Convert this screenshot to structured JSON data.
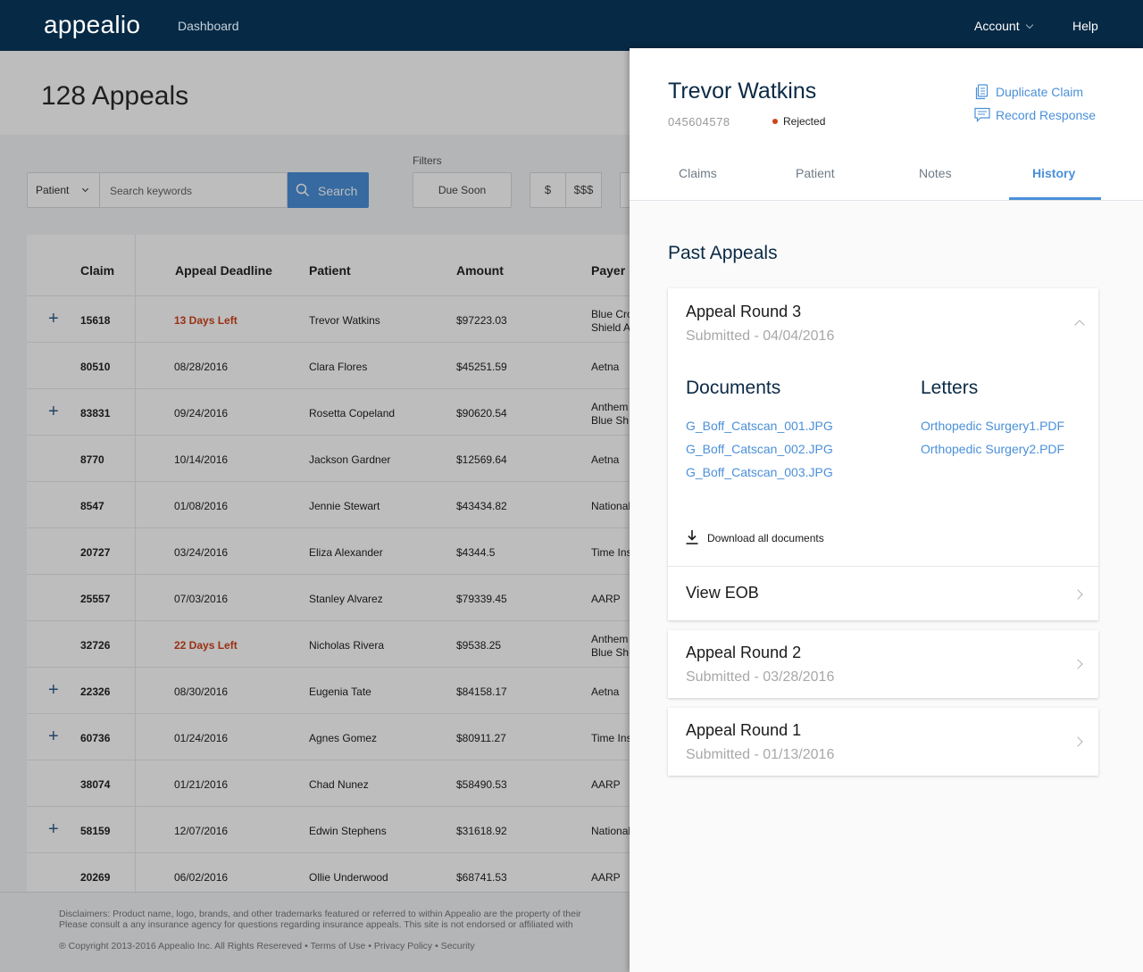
{
  "nav": {
    "brand": "appealio",
    "dashboard": "Dashboard",
    "account": "Account",
    "help": "Help"
  },
  "page": {
    "title": "128 Appeals",
    "filters_label": "Filters",
    "search": {
      "select_value": "Patient",
      "placeholder": "Search keywords",
      "button": "Search"
    },
    "filter_buttons": [
      "Due Soon",
      "$",
      "$$$"
    ]
  },
  "table": {
    "headers": {
      "claim": "Claim",
      "deadline": "Appeal Deadline",
      "patient": "Patient",
      "amount": "Amount",
      "payer": "Payer"
    },
    "rows": [
      {
        "claim": "15618",
        "deadline": "13 Days Left",
        "urgent": true,
        "patient": "Trevor Watkins",
        "amount": "$97223.03",
        "payer": "Blue Cross Shield A",
        "plus": true
      },
      {
        "claim": "80510",
        "deadline": "08/28/2016",
        "urgent": false,
        "patient": "Clara Flores",
        "amount": "$45251.59",
        "payer": "Aetna",
        "plus": false
      },
      {
        "claim": "83831",
        "deadline": "09/24/2016",
        "urgent": false,
        "patient": "Rosetta Copeland",
        "amount": "$90620.54",
        "payer": "Anthem Blue Sh",
        "plus": true
      },
      {
        "claim": "8770",
        "deadline": "10/14/2016",
        "urgent": false,
        "patient": "Jackson Gardner",
        "amount": "$12569.64",
        "payer": "Aetna",
        "plus": false
      },
      {
        "claim": "8547",
        "deadline": "01/08/2016",
        "urgent": false,
        "patient": "Jennie Stewart",
        "amount": "$43434.82",
        "payer": "National",
        "plus": false
      },
      {
        "claim": "20727",
        "deadline": "03/24/2016",
        "urgent": false,
        "patient": "Eliza Alexander",
        "amount": "$4344.5",
        "payer": "Time Ins",
        "plus": false
      },
      {
        "claim": "25557",
        "deadline": "07/03/2016",
        "urgent": false,
        "patient": "Stanley Alvarez",
        "amount": "$79339.45",
        "payer": "AARP",
        "plus": false
      },
      {
        "claim": "32726",
        "deadline": "22 Days Left",
        "urgent": true,
        "patient": "Nicholas Rivera",
        "amount": "$9538.25",
        "payer": "Anthem Blue Sh",
        "plus": false
      },
      {
        "claim": "22326",
        "deadline": "08/30/2016",
        "urgent": false,
        "patient": "Eugenia Tate",
        "amount": "$84158.17",
        "payer": "Aetna",
        "plus": true
      },
      {
        "claim": "60736",
        "deadline": "01/24/2016",
        "urgent": false,
        "patient": "Agnes Gomez",
        "amount": "$80911.27",
        "payer": "Time Ins",
        "plus": true
      },
      {
        "claim": "38074",
        "deadline": "01/21/2016",
        "urgent": false,
        "patient": "Chad Nunez",
        "amount": "$58490.53",
        "payer": "AARP",
        "plus": false
      },
      {
        "claim": "58159",
        "deadline": "12/07/2016",
        "urgent": false,
        "patient": "Edwin Stephens",
        "amount": "$31618.92",
        "payer": "National",
        "plus": true
      },
      {
        "claim": "20269",
        "deadline": "06/02/2016",
        "urgent": false,
        "patient": "Ollie Underwood",
        "amount": "$68741.53",
        "payer": "AARP",
        "plus": false
      }
    ]
  },
  "footer": {
    "disclaimer_1": "Disclaimers: Product name, logo, brands, and other trademarks featured or referred to within Appealio are the property of their",
    "disclaimer_2": "Please consult a any insurance agency for questions regarding insurance appeals. This site is not endorsed or affiliated with",
    "copyright": "® Copyright 2013-2016 Appealio Inc. All Rights Resereved • Terms of Use • Privacy Policy • Security"
  },
  "panel": {
    "name": "Trevor Watkins",
    "id": "045604578",
    "status": "Rejected",
    "actions": {
      "duplicate": "Duplicate Claim",
      "record": "Record Response"
    },
    "tabs": [
      "Claims",
      "Patient",
      "Notes",
      "History"
    ],
    "active_tab": "History",
    "past_title": "Past Appeals",
    "rounds": [
      {
        "title": "Appeal Round 3",
        "submitted": "Submitted - 04/04/2016",
        "expanded": true,
        "documents_title": "Documents",
        "documents": [
          "G_Boff_Catscan_001.JPG",
          "G_Boff_Catscan_002.JPG",
          "G_Boff_Catscan_003.JPG"
        ],
        "letters_title": "Letters",
        "letters": [
          "Orthopedic Surgery1.PDF",
          "Orthopedic Surgery2.PDF"
        ],
        "download": "Download all documents",
        "eob": "View EOB"
      },
      {
        "title": "Appeal Round 2",
        "submitted": "Submitted - 03/28/2016",
        "expanded": false
      },
      {
        "title": "Appeal Round 1",
        "submitted": "Submitted - 01/13/2016",
        "expanded": false
      }
    ]
  },
  "colors": {
    "nav": "#062945",
    "accent": "#4a90d9",
    "urgent": "#d0421b",
    "heading": "#0b2a45"
  },
  "icons": [
    "search-icon",
    "chevron-down-icon",
    "plus-icon",
    "duplicate-icon",
    "comment-icon",
    "chevron-up-icon",
    "chevron-right-icon",
    "download-icon",
    "status-dot-icon"
  ]
}
